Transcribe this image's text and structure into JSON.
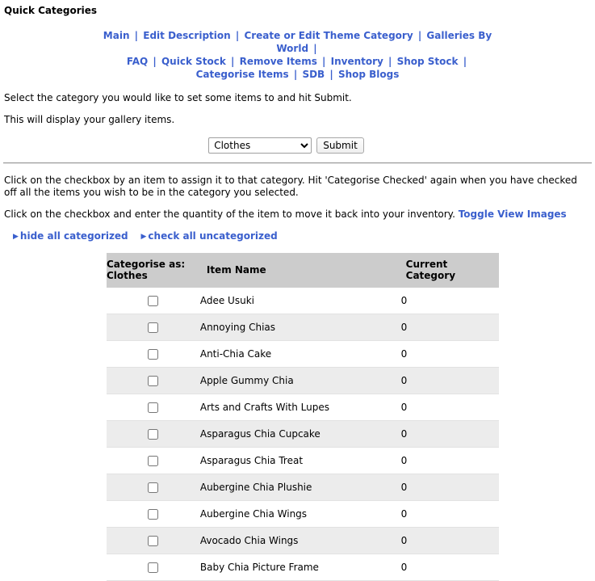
{
  "page": {
    "title": "Quick Categories"
  },
  "nav": {
    "separator": "|",
    "links": [
      "Main",
      "Edit Description",
      "Create or Edit Theme Category",
      "Galleries By World",
      "FAQ",
      "Quick Stock",
      "Remove Items",
      "Inventory",
      "Shop Stock",
      "Categorise Items",
      "SDB",
      "Shop Blogs"
    ],
    "line_breaks_after": [
      3,
      8
    ]
  },
  "intro": {
    "line1": "Select the category you would like to set some items to and hit Submit.",
    "line2": "This will display your gallery items."
  },
  "category_form": {
    "selected": "Clothes",
    "options": [
      "Clothes"
    ],
    "submit_label": "Submit"
  },
  "instructions": {
    "paragraph1": "Click on the checkbox by an item to assign it to that category. Hit 'Categorise Checked' again when you have checked off all the items you wish to be in the category you selected.",
    "paragraph2_text": "Click on the checkbox and enter the quantity of the item to move it back into your inventory.",
    "toggle_images_link": "Toggle View Images"
  },
  "toggles": {
    "marker": "▶",
    "hide_all": "hide all categorized",
    "check_all": "check all uncategorized"
  },
  "table": {
    "headers": {
      "categorise_as_line1": "Categorise as:",
      "categorise_as_line2": "Clothes",
      "item_name": "Item Name",
      "current_category": "Current Category"
    },
    "rows": [
      {
        "name": "Adee Usuki",
        "category": "0",
        "checked": false
      },
      {
        "name": "Annoying Chias",
        "category": "0",
        "checked": false
      },
      {
        "name": "Anti-Chia Cake",
        "category": "0",
        "checked": false
      },
      {
        "name": "Apple Gummy Chia",
        "category": "0",
        "checked": false
      },
      {
        "name": "Arts and Crafts With Lupes",
        "category": "0",
        "checked": false
      },
      {
        "name": "Asparagus Chia Cupcake",
        "category": "0",
        "checked": false
      },
      {
        "name": "Asparagus Chia Treat",
        "category": "0",
        "checked": false
      },
      {
        "name": "Aubergine Chia Plushie",
        "category": "0",
        "checked": false
      },
      {
        "name": "Aubergine Chia Wings",
        "category": "0",
        "checked": false
      },
      {
        "name": "Avocado Chia Wings",
        "category": "0",
        "checked": false
      },
      {
        "name": "Baby Chia Picture Frame",
        "category": "0",
        "checked": false
      }
    ]
  },
  "colors": {
    "link": "#3a5fcd",
    "header_bg": "#cccccc",
    "row_alt_bg": "#ececec",
    "row_bg": "#ffffff"
  }
}
